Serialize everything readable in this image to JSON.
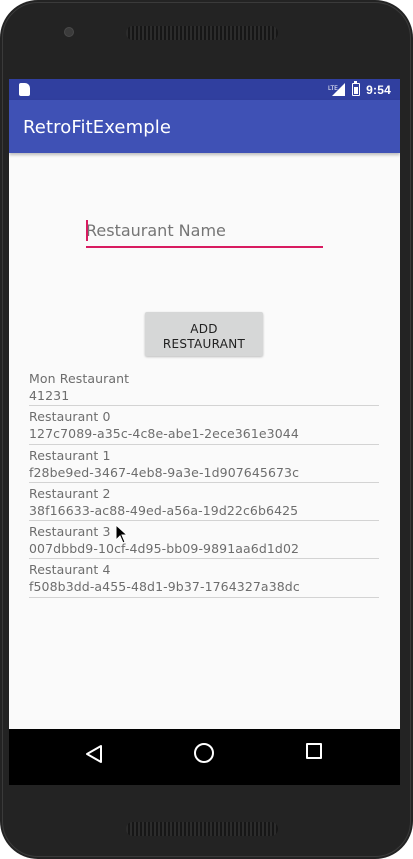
{
  "status_bar": {
    "time": "9:54",
    "icons": [
      "sd-card-icon",
      "no-sim-signal-icon",
      "battery-charging-icon"
    ]
  },
  "app_bar": {
    "title": "RetroFitExemple"
  },
  "form": {
    "name_placeholder": "Restaurant Name",
    "name_value": "",
    "add_button_label": "ADD\nRESTAURANT"
  },
  "restaurants": [
    {
      "name": "Mon Restaurant",
      "id": "41231"
    },
    {
      "name": "Restaurant 0",
      "id": "127c7089-a35c-4c8e-abe1-2ece361e3044"
    },
    {
      "name": "Restaurant 1",
      "id": "f28be9ed-3467-4eb8-9a3e-1d907645673c"
    },
    {
      "name": "Restaurant 2",
      "id": "38f16633-ac88-49ed-a56a-19d22c6b6425"
    },
    {
      "name": "Restaurant 3",
      "id": "007dbbd9-10cf-4d95-bb09-9891aa6d1d02"
    },
    {
      "name": "Restaurant 4",
      "id": "f508b3dd-a455-48d1-9b37-1764327a38dc"
    }
  ],
  "nav_bar": {
    "icons": [
      "back-icon",
      "home-icon",
      "recent-apps-icon"
    ]
  },
  "colors": {
    "primary": "#3f51b5",
    "primary_dark": "#303f9f",
    "accent": "#d81b60",
    "background": "#fafafa"
  }
}
